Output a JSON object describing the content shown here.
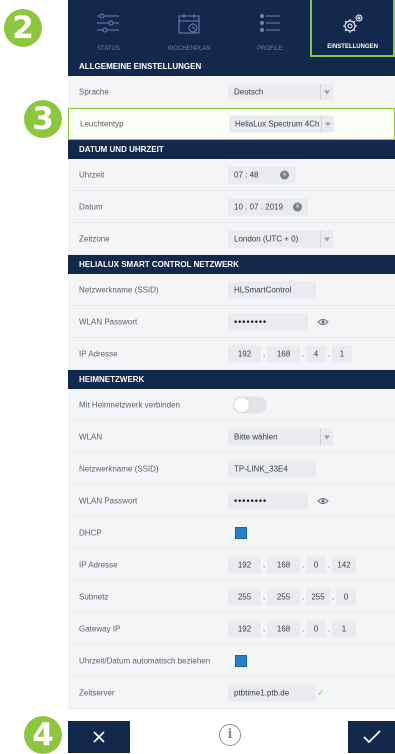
{
  "callouts": {
    "b2": "2",
    "b3": "3",
    "b4": "4"
  },
  "nav": {
    "tabs": [
      {
        "label": "STATUS",
        "icon": "sliders-icon"
      },
      {
        "label": "WOCHENPLAN",
        "icon": "calendar-icon"
      },
      {
        "label": "PROFILE",
        "icon": "list-icon"
      },
      {
        "label": "EINSTELLUNGEN",
        "icon": "gear-icon",
        "active": true
      }
    ]
  },
  "general": {
    "title": "ALLGEMEINE EINSTELLUNGEN",
    "language_label": "Sprache",
    "language_value": "Deutsch",
    "light_label": "Leuchtentyp",
    "light_value": "HeliaLux Spectrum 4Ch"
  },
  "datetime": {
    "title": "DATUM UND UHRZEIT",
    "time_label": "Uhrzeit",
    "time_value": "07 : 48",
    "date_label": "Datum",
    "date_value": "10 . 07 . 2019",
    "tz_label": "Zeitzone",
    "tz_value": "London (UTC + 0)"
  },
  "smart": {
    "title": "HELIALUX SMART CONTROL NETZWERK",
    "ssid_label": "Netzwerkname (SSID)",
    "ssid_value": "HLSmartControl",
    "pw_label": "WLAN Passwort",
    "pw_value": "••••••••",
    "ip_label": "IP Adresse",
    "ip": [
      "192",
      "168",
      "4",
      "1"
    ]
  },
  "home": {
    "title": "HEIMNETZWERK",
    "connect_label": "Mit Heimnetzwerk verbinden",
    "wlan_label": "WLAN",
    "wlan_value": "Bitte wählen",
    "ssid_label": "Netzwerkname (SSID)",
    "ssid_value": "TP-LINK_33E4",
    "pw_label": "WLAN Passwort",
    "pw_value": "••••••••",
    "dhcp_label": "DHCP",
    "ip_label": "IP Adresse",
    "ip": [
      "192",
      "168",
      "0",
      "142"
    ],
    "subnet_label": "Subnetz",
    "subnet": [
      "255",
      "255",
      "255",
      "0"
    ],
    "gateway_label": "Gateway IP",
    "gateway": [
      "192",
      "168",
      "0",
      "1"
    ],
    "auto_label": "Uhrzeit/Datum automatisch beziehen",
    "ntp_label": "Zeitserver",
    "ntp_value": "ptbtime1.ptb.de",
    "ntp_check": "✓"
  },
  "footer": {
    "info": "i"
  },
  "colors": {
    "navy": "#12284d",
    "green": "#8dc63f",
    "blue": "#2a80c8"
  }
}
